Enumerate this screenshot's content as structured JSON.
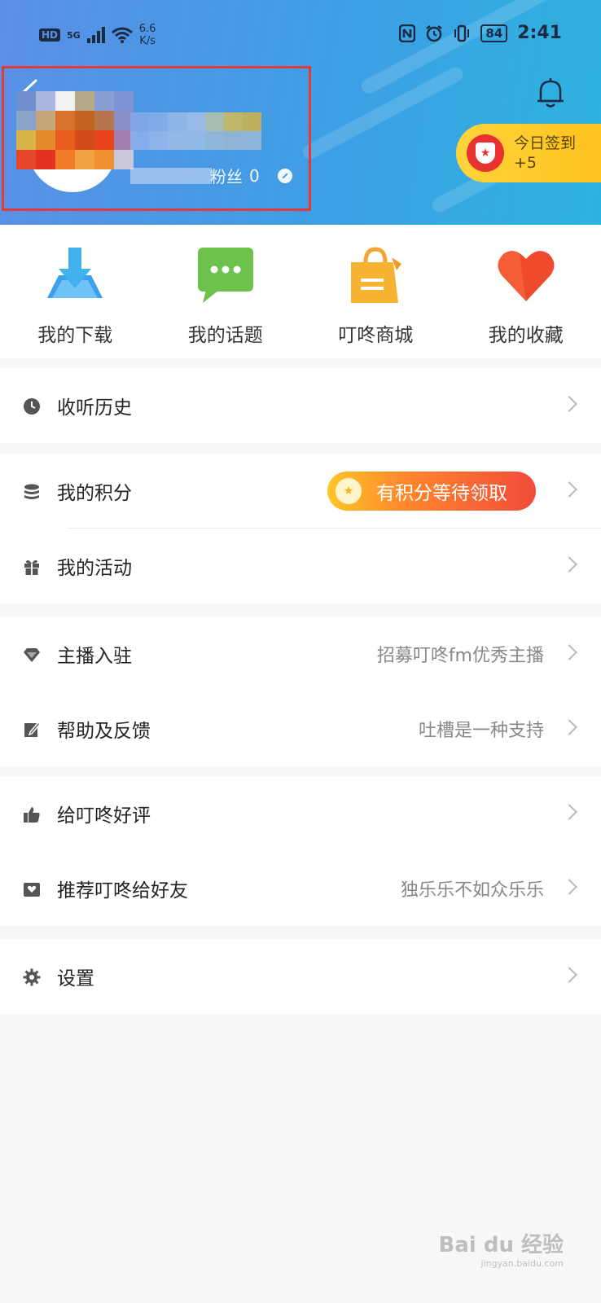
{
  "status_bar": {
    "network": "HD",
    "signal": "5G",
    "speed_value": "6.6",
    "speed_unit": "K/s",
    "battery": "84",
    "time": "2:41"
  },
  "header": {
    "fans_label": "粉丝",
    "fans_count": "0",
    "checkin_title": "今日签到",
    "checkin_reward": "+5"
  },
  "quick_actions": [
    {
      "label": "我的下载",
      "icon": "download-icon"
    },
    {
      "label": "我的话题",
      "icon": "chat-bubble-icon"
    },
    {
      "label": "叮咚商城",
      "icon": "shopping-bag-icon"
    },
    {
      "label": "我的收藏",
      "icon": "heart-icon"
    }
  ],
  "menu": {
    "history": {
      "label": "收听历史"
    },
    "points": {
      "label": "我的积分",
      "badge": "有积分等待领取"
    },
    "activities": {
      "label": "我的活动"
    },
    "anchor": {
      "label": "主播入驻",
      "hint": "招募叮咚fm优秀主播"
    },
    "feedback": {
      "label": "帮助及反馈",
      "hint": "吐槽是一种支持"
    },
    "review": {
      "label": "给叮咚好评"
    },
    "recommend": {
      "label": "推荐叮咚给好友",
      "hint": "独乐乐不如众乐乐"
    },
    "settings": {
      "label": "设置"
    }
  },
  "watermark": {
    "brand": "Bai du 经验",
    "url": "jingyan.baidu.com"
  },
  "colors": {
    "accent": "#3d9fe4",
    "highlight_box": "#e43a3a",
    "checkin": "#ffd53a"
  }
}
